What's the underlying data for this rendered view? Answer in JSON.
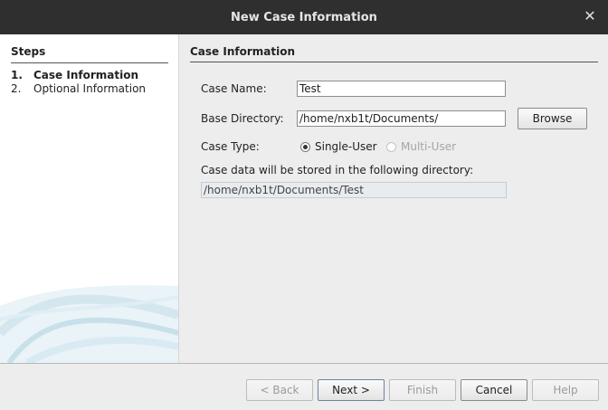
{
  "window": {
    "title": "New Case Information",
    "close_icon": "close-icon"
  },
  "steps": {
    "title": "Steps",
    "items": [
      {
        "number": "1.",
        "label": "Case Information"
      },
      {
        "number": "2.",
        "label": "Optional Information"
      }
    ]
  },
  "form": {
    "title": "Case Information",
    "case_name_label": "Case Name:",
    "case_name_value": "Test",
    "base_dir_label": "Base Directory:",
    "base_dir_value": "/home/nxb1t/Documents/",
    "browse_label": "Browse",
    "case_type_label": "Case Type:",
    "single_user_label": "Single-User",
    "multi_user_label": "Multi-User",
    "storage_note": "Case data will be stored in the following directory:",
    "storage_path": "/home/nxb1t/Documents/Test"
  },
  "buttons": {
    "back": "< Back",
    "next": "Next >",
    "finish": "Finish",
    "cancel": "Cancel",
    "help": "Help"
  }
}
